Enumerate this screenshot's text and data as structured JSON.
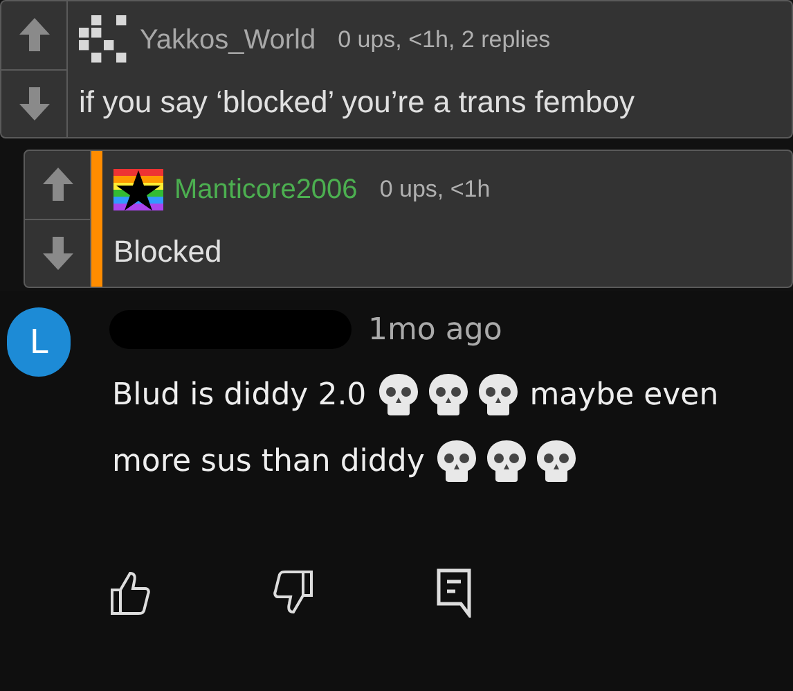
{
  "comments": [
    {
      "username": "Yakkos_World",
      "meta": "0 ups, <1h, 2 replies",
      "text": "if you say ‘blocked’ you’re a trans femboy",
      "reply": false,
      "kind": "pixels"
    },
    {
      "username": "Manticore2006",
      "meta": "0 ups, <1h",
      "text": "Blocked",
      "reply": true,
      "kind": "star"
    }
  ],
  "youtube_comment": {
    "avatar_letter": "L",
    "time": "1mo ago",
    "lines": [
      [
        {
          "kind": "text",
          "text": "Blud is diddy 2.0"
        },
        {
          "kind": "skull"
        },
        {
          "kind": "skull"
        },
        {
          "kind": "skull"
        },
        {
          "kind": "text",
          "text": "maybe even"
        }
      ],
      [
        {
          "kind": "text",
          "text": "more sus than diddy"
        },
        {
          "kind": "skull"
        },
        {
          "kind": "skull"
        },
        {
          "kind": "skull"
        }
      ]
    ]
  }
}
